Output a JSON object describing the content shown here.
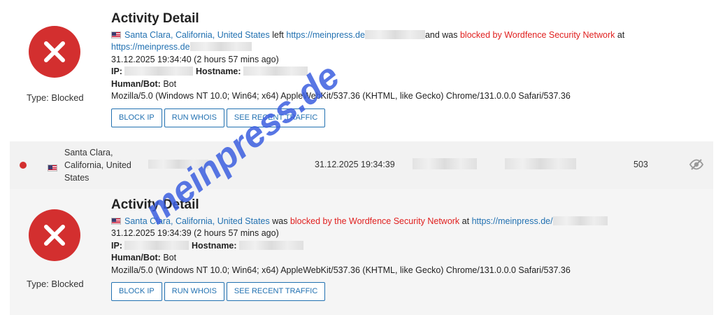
{
  "details": [
    {
      "title": "Activity Detail",
      "type_label": "Type: Blocked",
      "location": "Santa Clara, California, United States",
      "text_left": " left ",
      "url_1": "https://meinpress.de",
      "text_and": "and was ",
      "blocked_text": "blocked by Wordfence Security Network",
      "text_at": " at",
      "url_2": "https://meinpress.de",
      "timestamp": "31.12.2025 19:34:40 (2 hours 57 mins ago)",
      "ip_label": "IP:",
      "hostname_label": "Hostname:",
      "humanbot_label": "Human/Bot:",
      "humanbot_value": "Bot",
      "user_agent": "Mozilla/5.0 (Windows NT 10.0; Win64; x64) AppleWebKit/537.36 (KHTML, like Gecko) Chrome/131.0.0.0 Safari/537.36",
      "buttons": [
        "BLOCK IP",
        "RUN WHOIS",
        "SEE RECENT TRAFFIC"
      ]
    },
    {
      "title": "Activity Detail",
      "type_label": "Type: Blocked",
      "location": "Santa Clara, California, United States",
      "text_was": " was ",
      "blocked_text": "blocked by the Wordfence Security Network",
      "text_at": " at ",
      "url_1": "https://meinpress.de/",
      "timestamp": "31.12.2025 19:34:39 (2 hours 57 mins ago)",
      "ip_label": "IP:",
      "hostname_label": "Hostname:",
      "humanbot_label": "Human/Bot:",
      "humanbot_value": "Bot",
      "user_agent": "Mozilla/5.0 (Windows NT 10.0; Win64; x64) AppleWebKit/537.36 (KHTML, like Gecko) Chrome/131.0.0.0 Safari/537.36",
      "buttons": [
        "BLOCK IP",
        "RUN WHOIS",
        "SEE RECENT TRAFFIC"
      ]
    }
  ],
  "row": {
    "location": "Santa Clara, California, United States",
    "timestamp": "31.12.2025 19:34:39",
    "status_code": "503",
    "status_dot_color": "#d32f2f",
    "action_icon": "eye-slash-icon"
  },
  "watermark": "meinpress.de",
  "colors": {
    "link": "#2271b1",
    "blocked": "#e0201f",
    "error_icon": "#d32f2f"
  }
}
